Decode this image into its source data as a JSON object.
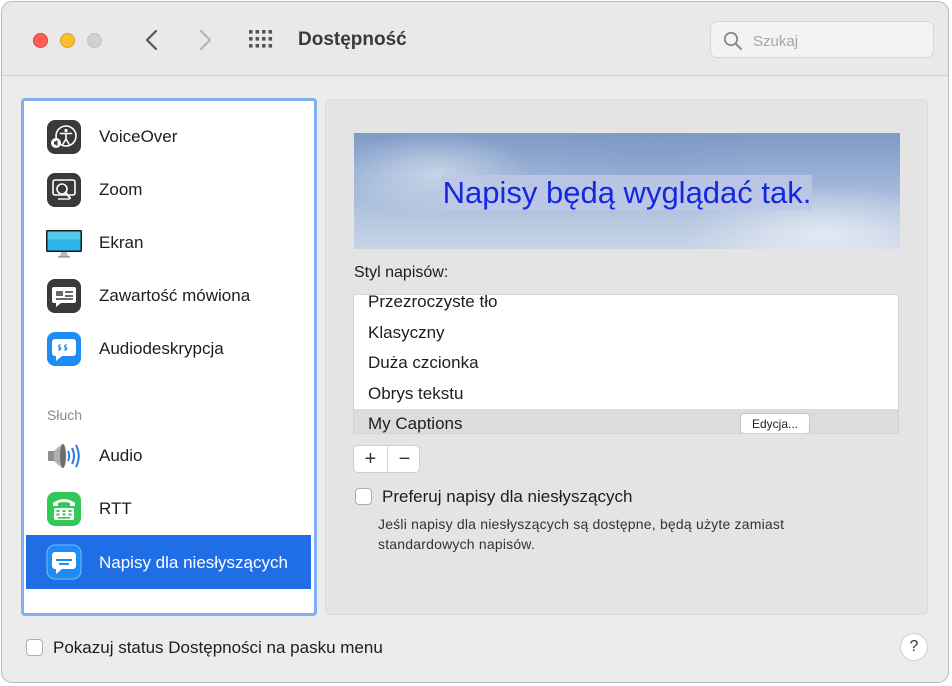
{
  "window": {
    "title": "Dostępność"
  },
  "search": {
    "placeholder": "Szukaj"
  },
  "sidebar": {
    "items": [
      {
        "label": "VoiceOver",
        "icon": "voiceover-icon"
      },
      {
        "label": "Zoom",
        "icon": "zoom-icon"
      },
      {
        "label": "Ekran",
        "icon": "display-icon"
      },
      {
        "label": "Zawartość mówiona",
        "icon": "spoken-content-icon"
      },
      {
        "label": "Audiodeskrypcja",
        "icon": "audio-description-icon"
      }
    ],
    "section_header": "Słuch",
    "hearing_items": [
      {
        "label": "Audio",
        "icon": "speaker-icon"
      },
      {
        "label": "RTT",
        "icon": "rtt-icon"
      },
      {
        "label": "Napisy dla niesłyszących",
        "icon": "captions-icon",
        "selected": true
      }
    ],
    "selection_color": "#1f6ee6"
  },
  "content": {
    "preview_text": "Napisy będą wyglądać tak.",
    "style_label": "Styl napisów:",
    "styles": [
      "Przezroczyste tło",
      "Klasyczny",
      "Duża czcionka",
      "Obrys tekstu",
      "My Captions"
    ],
    "selected_style": "My Captions",
    "edit_button": "Edycja...",
    "add_button": "+",
    "remove_button": "−",
    "prefer_sdh_label": "Preferuj napisy dla niesłyszących",
    "prefer_sdh_checked": false,
    "prefer_sdh_description": "Jeśli napisy dla niesłyszących są dostępne, będą użyte zamiast standardowych napisów."
  },
  "footer": {
    "menu_status_label": "Pokazuj status Dostępności na pasku menu",
    "menu_status_checked": false,
    "help_label": "?"
  }
}
